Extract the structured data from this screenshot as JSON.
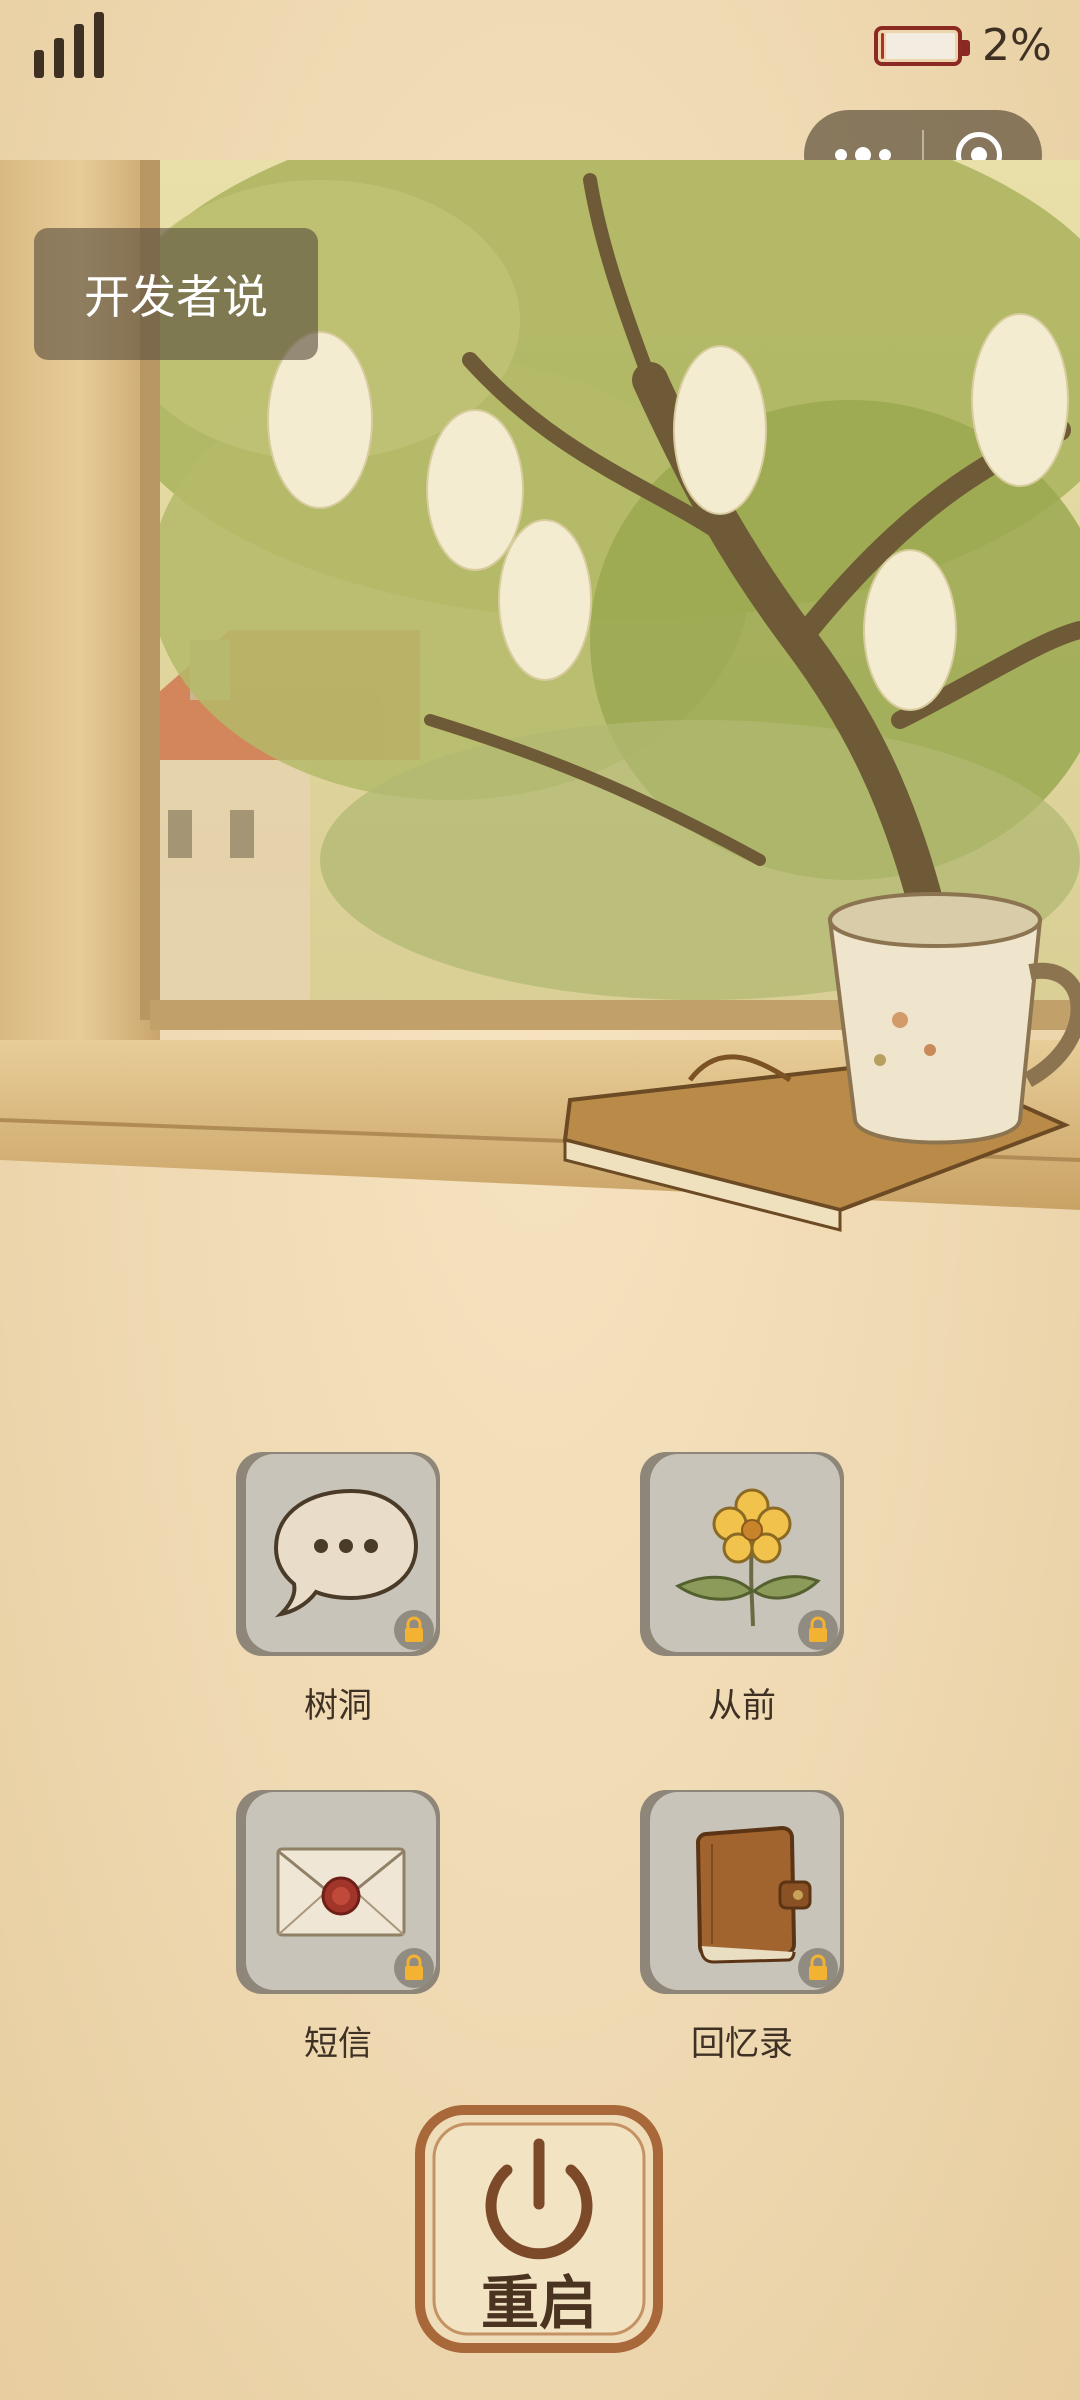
{
  "status_bar": {
    "battery_percent": "2%",
    "battery_level": 0.02
  },
  "capsule": {
    "more_icon": "more-dots-icon",
    "close_icon": "target-circle-icon"
  },
  "developer_button": {
    "label": "开发者说"
  },
  "apps": [
    {
      "label": "树洞",
      "icon": "speech-bubble-icon",
      "locked": true
    },
    {
      "label": "从前",
      "icon": "flower-icon",
      "locked": true
    },
    {
      "label": "短信",
      "icon": "sealed-envelope-icon",
      "locked": true
    },
    {
      "label": "回忆录",
      "icon": "leather-journal-icon",
      "locked": true
    }
  ],
  "restart_button": {
    "label": "重启",
    "icon": "power-icon"
  },
  "colors": {
    "background": "#efd9b2",
    "text": "#3e3124",
    "battery_low": "#b33226"
  }
}
